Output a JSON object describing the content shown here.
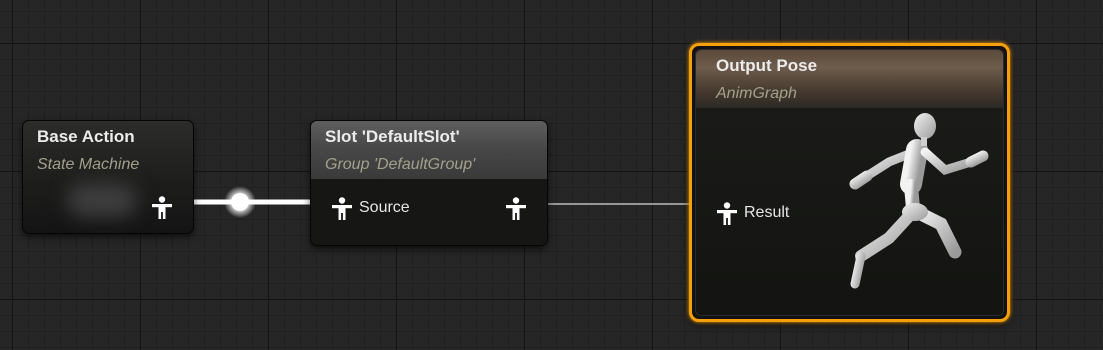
{
  "graph": {
    "nodes": {
      "base_action": {
        "title": "Base Action",
        "subtitle": "State Machine",
        "output_pin_icon": "pose-pin-icon"
      },
      "slot": {
        "title": "Slot 'DefaultSlot'",
        "subtitle": "Group 'DefaultGroup'",
        "input_pin_label": "Source",
        "pin_icon": "pose-pin-icon"
      },
      "output_pose": {
        "title": "Output Pose",
        "subtitle": "AnimGraph",
        "input_pin_label": "Result",
        "preview_icon": "running-mannequin-icon",
        "selected": true
      }
    },
    "colors": {
      "selection": "#f5a00b",
      "pin": "#ffffff",
      "subtitle": "#a3a18b",
      "grid_background": "#262626"
    }
  }
}
